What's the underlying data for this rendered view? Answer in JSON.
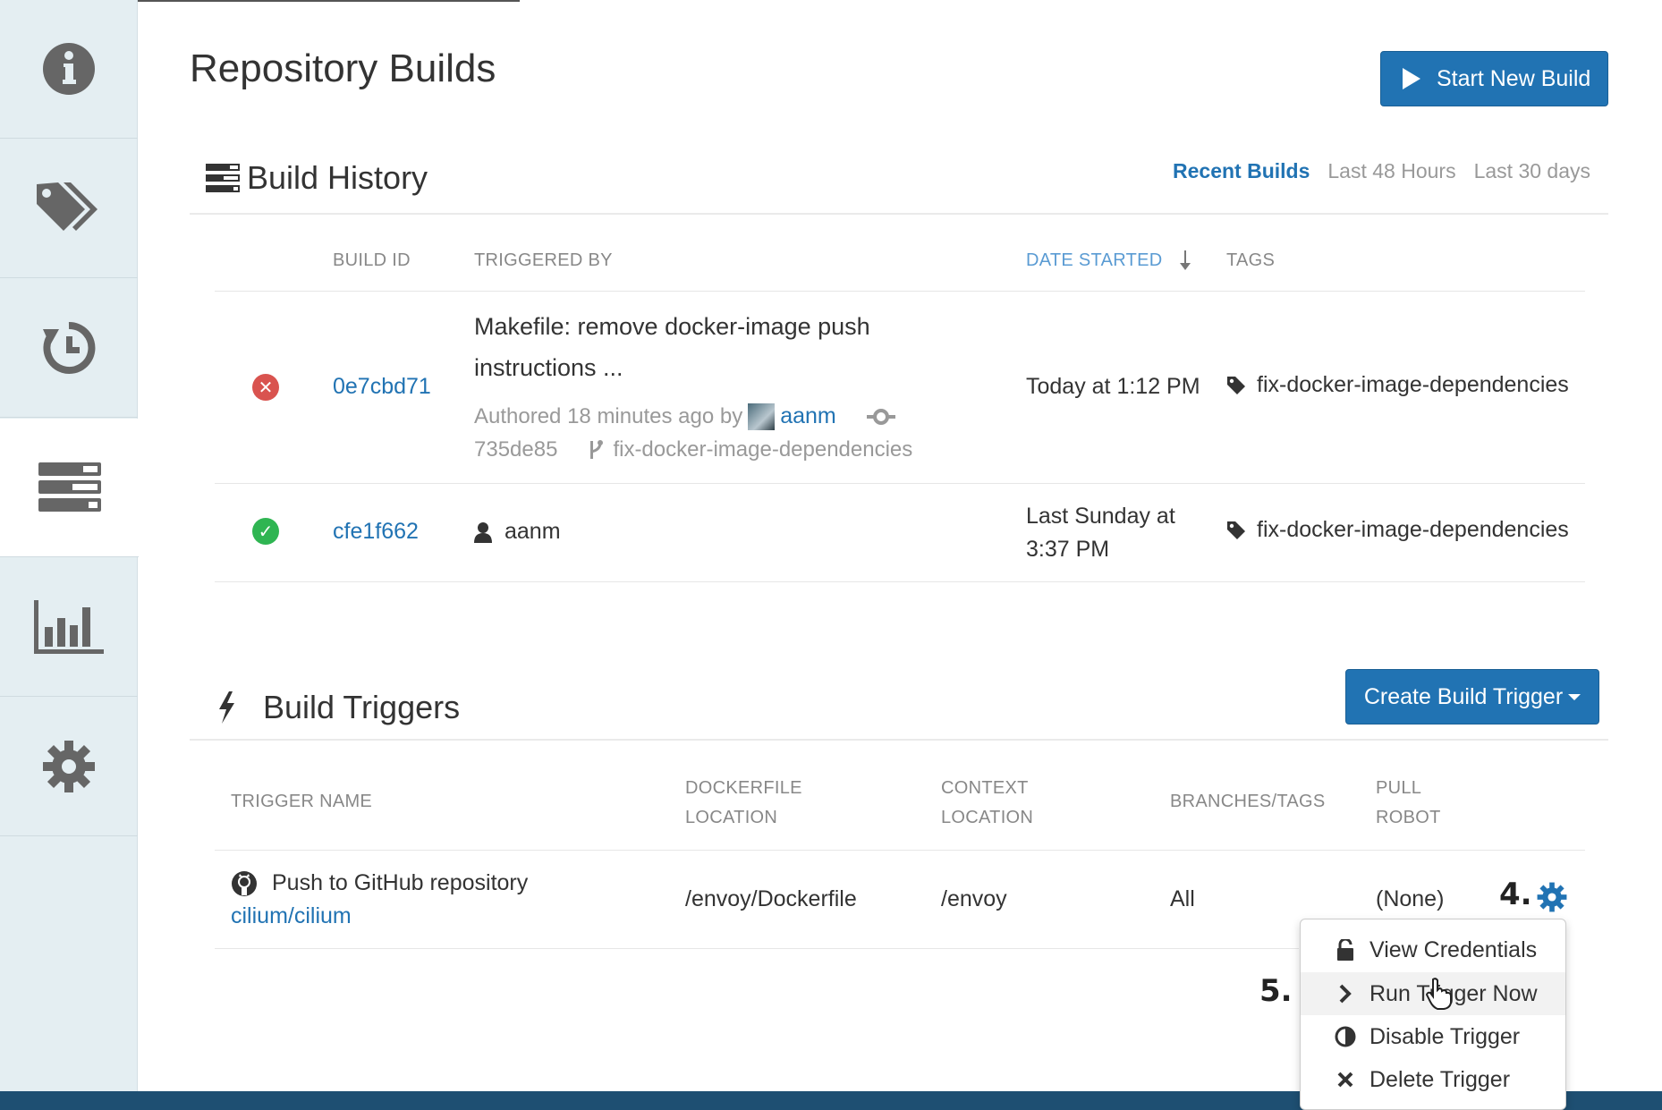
{
  "page": {
    "title": "Repository Builds"
  },
  "header": {
    "start_build_label": "Start New Build"
  },
  "sidebar": {
    "items": [
      {
        "name": "info",
        "icon": "info-icon"
      },
      {
        "name": "tags",
        "icon": "tags-icon"
      },
      {
        "name": "history",
        "icon": "history-icon"
      },
      {
        "name": "builds",
        "icon": "builds-icon",
        "active": true
      },
      {
        "name": "usage",
        "icon": "bar-chart-icon"
      },
      {
        "name": "settings",
        "icon": "gear-icon"
      }
    ]
  },
  "build_history": {
    "title": "Build History",
    "filters": [
      "Recent Builds",
      "Last 48 Hours",
      "Last 30 days"
    ],
    "active_filter": "Recent Builds",
    "columns": {
      "build_id": "BUILD ID",
      "triggered_by": "TRIGGERED BY",
      "date_started": "DATE STARTED",
      "tags": "TAGS"
    },
    "rows": [
      {
        "status": "failed",
        "build_id": "0e7cbd71",
        "commit_message_line1": "Makefile: remove docker-image push",
        "commit_message_line2": "instructions ...",
        "authored_prefix": "Authored 18 minutes ago by",
        "author": "aanm",
        "commit_sha": "735de85",
        "branch": "fix-docker-image-dependencies",
        "date": "Today at 1:12 PM",
        "tag": "fix-docker-image-dependencies"
      },
      {
        "status": "success",
        "build_id": "cfe1f662",
        "user": "aanm",
        "date_line1": "Last Sunday at",
        "date_line2": "3:37 PM",
        "tag": "fix-docker-image-dependencies"
      }
    ]
  },
  "build_triggers": {
    "title": "Build Triggers",
    "create_label": "Create Build Trigger",
    "columns": {
      "trigger_name": "TRIGGER NAME",
      "dockerfile_l1": "DOCKERFILE",
      "dockerfile_l2": "LOCATION",
      "context_l1": "CONTEXT",
      "context_l2": "LOCATION",
      "branches": "BRANCHES/TAGS",
      "robot_l1": "PULL",
      "robot_l2": "ROBOT"
    },
    "rows": [
      {
        "trigger_name": "Push to GitHub repository",
        "repo": "cilium/cilium",
        "dockerfile": "/envoy/Dockerfile",
        "context": "/envoy",
        "branches": "All",
        "robot": "(None)"
      }
    ],
    "step_4": "4.",
    "step_5": "5.",
    "menu": [
      "View Credentials",
      "Run Trigger Now",
      "Disable Trigger",
      "Delete Trigger"
    ]
  },
  "colors": {
    "accent": "#2173b3",
    "sidebar": "#e4eef2",
    "fail": "#d9534f",
    "success": "#2fb552",
    "footer": "#1e4f72"
  }
}
